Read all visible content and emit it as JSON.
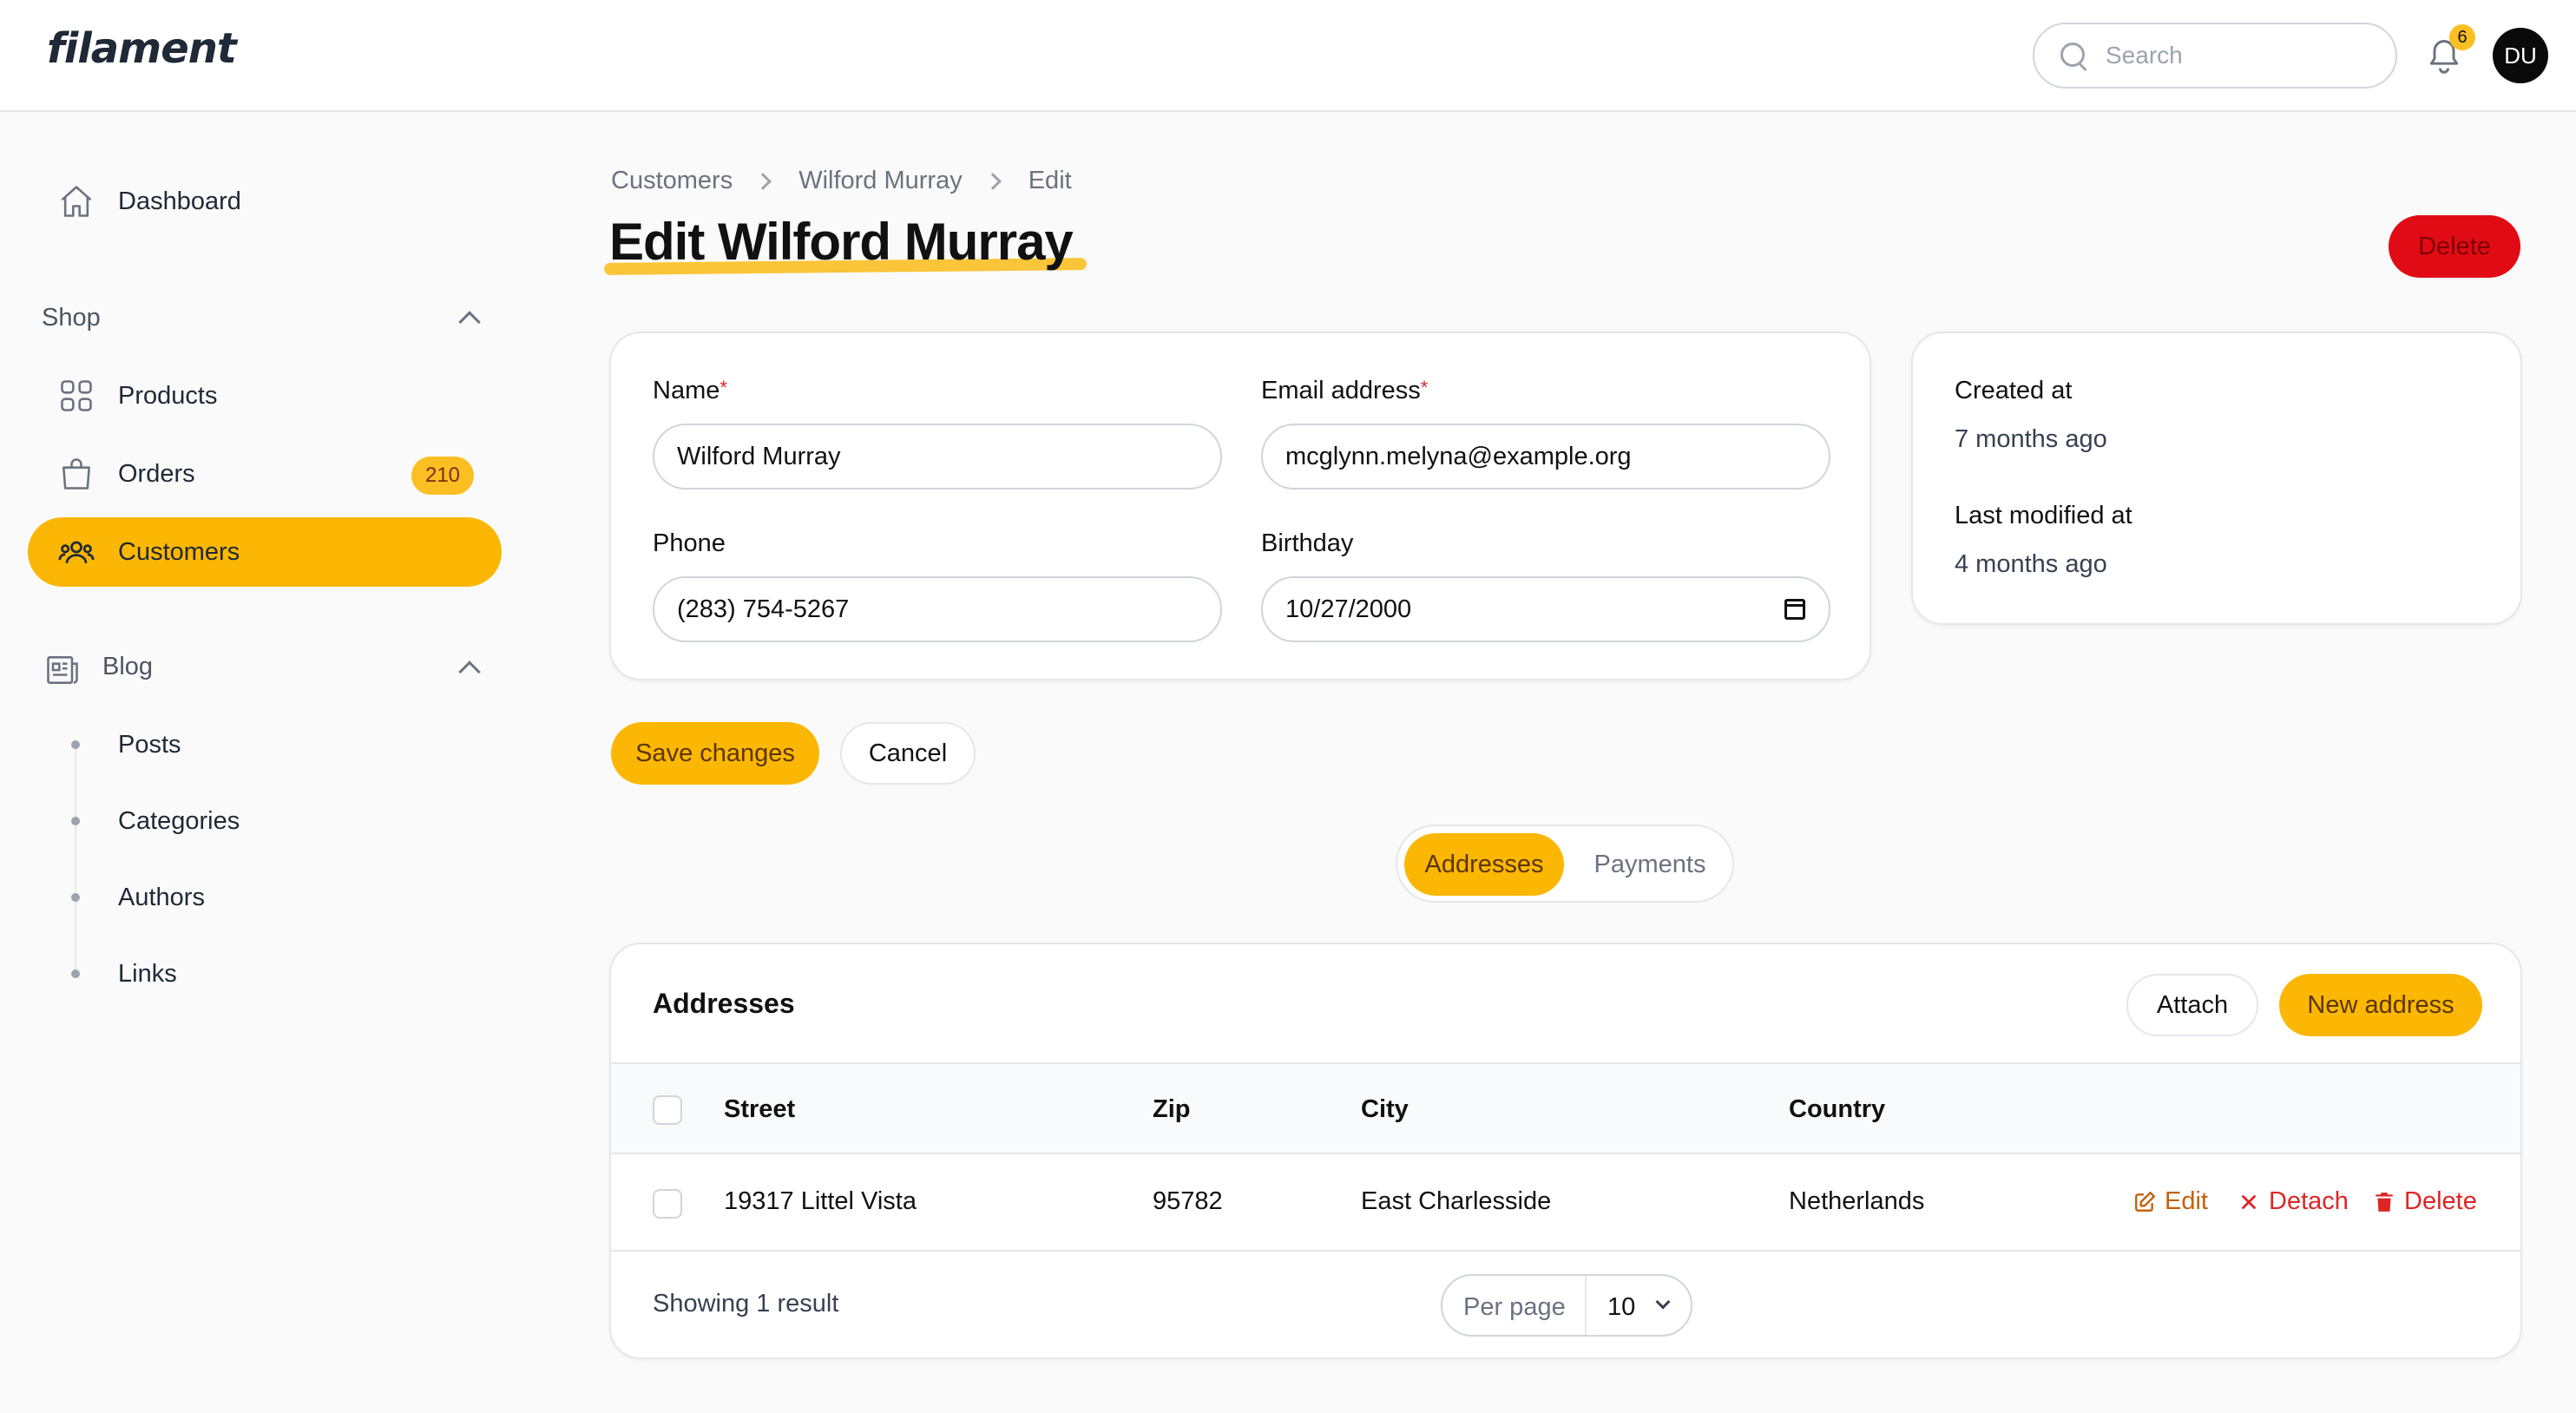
{
  "header": {
    "brand": "filament",
    "search_placeholder": "Search",
    "notification_count": "6",
    "avatar_initials": "DU"
  },
  "sidebar": {
    "dashboard": "Dashboard",
    "shop_label": "Shop",
    "products": "Products",
    "orders": "Orders",
    "orders_badge": "210",
    "customers": "Customers",
    "blog_label": "Blog",
    "blog_items": [
      "Posts",
      "Categories",
      "Authors",
      "Links"
    ]
  },
  "breadcrumb": [
    "Customers",
    "Wilford Murray",
    "Edit"
  ],
  "page": {
    "title": "Edit Wilford Murray",
    "delete_label": "Delete"
  },
  "form": {
    "name_label": "Name",
    "name_value": "Wilford Murray",
    "email_label": "Email address",
    "email_value": "mcglynn.melyna@example.org",
    "phone_label": "Phone",
    "phone_value": "(283) 754-5267",
    "birthday_label": "Birthday",
    "birthday_value": "10/27/2000",
    "required_mark": "*"
  },
  "meta": {
    "created_label": "Created at",
    "created_value": "7 months ago",
    "modified_label": "Last modified at",
    "modified_value": "4 months ago"
  },
  "actions": {
    "save": "Save changes",
    "cancel": "Cancel"
  },
  "tabs": [
    "Addresses",
    "Payments"
  ],
  "table": {
    "heading": "Addresses",
    "attach": "Attach",
    "new_address": "New address",
    "columns": [
      "Street",
      "Zip",
      "City",
      "Country"
    ],
    "rows": [
      {
        "street": "19317 Littel Vista",
        "zip": "95782",
        "city": "East Charlesside",
        "country": "Netherlands"
      }
    ],
    "row_actions": [
      "Edit",
      "Detach",
      "Delete"
    ],
    "footer": "Showing 1 result",
    "per_page_label": "Per page",
    "per_page_value": "10"
  },
  "colors": {
    "primary": "#fbb703",
    "danger": "#e00b14"
  }
}
